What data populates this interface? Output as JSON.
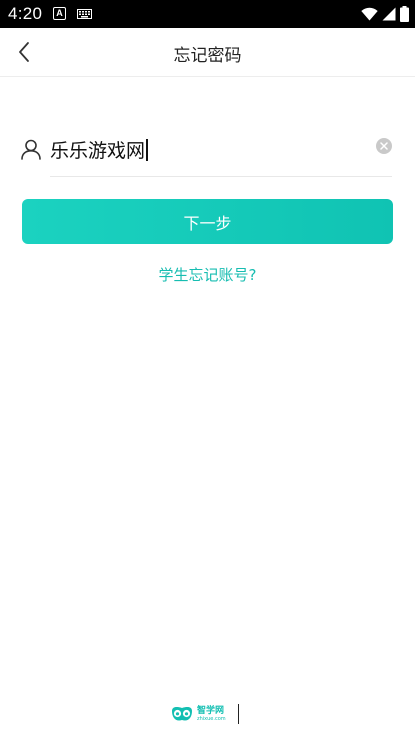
{
  "status_bar": {
    "time": "4:20",
    "notif_letter": "A"
  },
  "header": {
    "title": "忘记密码"
  },
  "form": {
    "account_value": "乐乐游戏网",
    "next_label": "下一步",
    "student_link": "学生忘记账号?"
  },
  "footer": {
    "logo_cn": "智学网",
    "logo_en": "zhixue.com"
  },
  "colors": {
    "accent": "#17bdb1",
    "button_start": "#1bd2c0",
    "button_end": "#10c3b3"
  },
  "icons": [
    "back-arrow-icon",
    "user-icon",
    "clear-icon",
    "wifi-icon",
    "signal-icon",
    "battery-icon",
    "keyboard-icon",
    "zhixue-logo-icon"
  ]
}
